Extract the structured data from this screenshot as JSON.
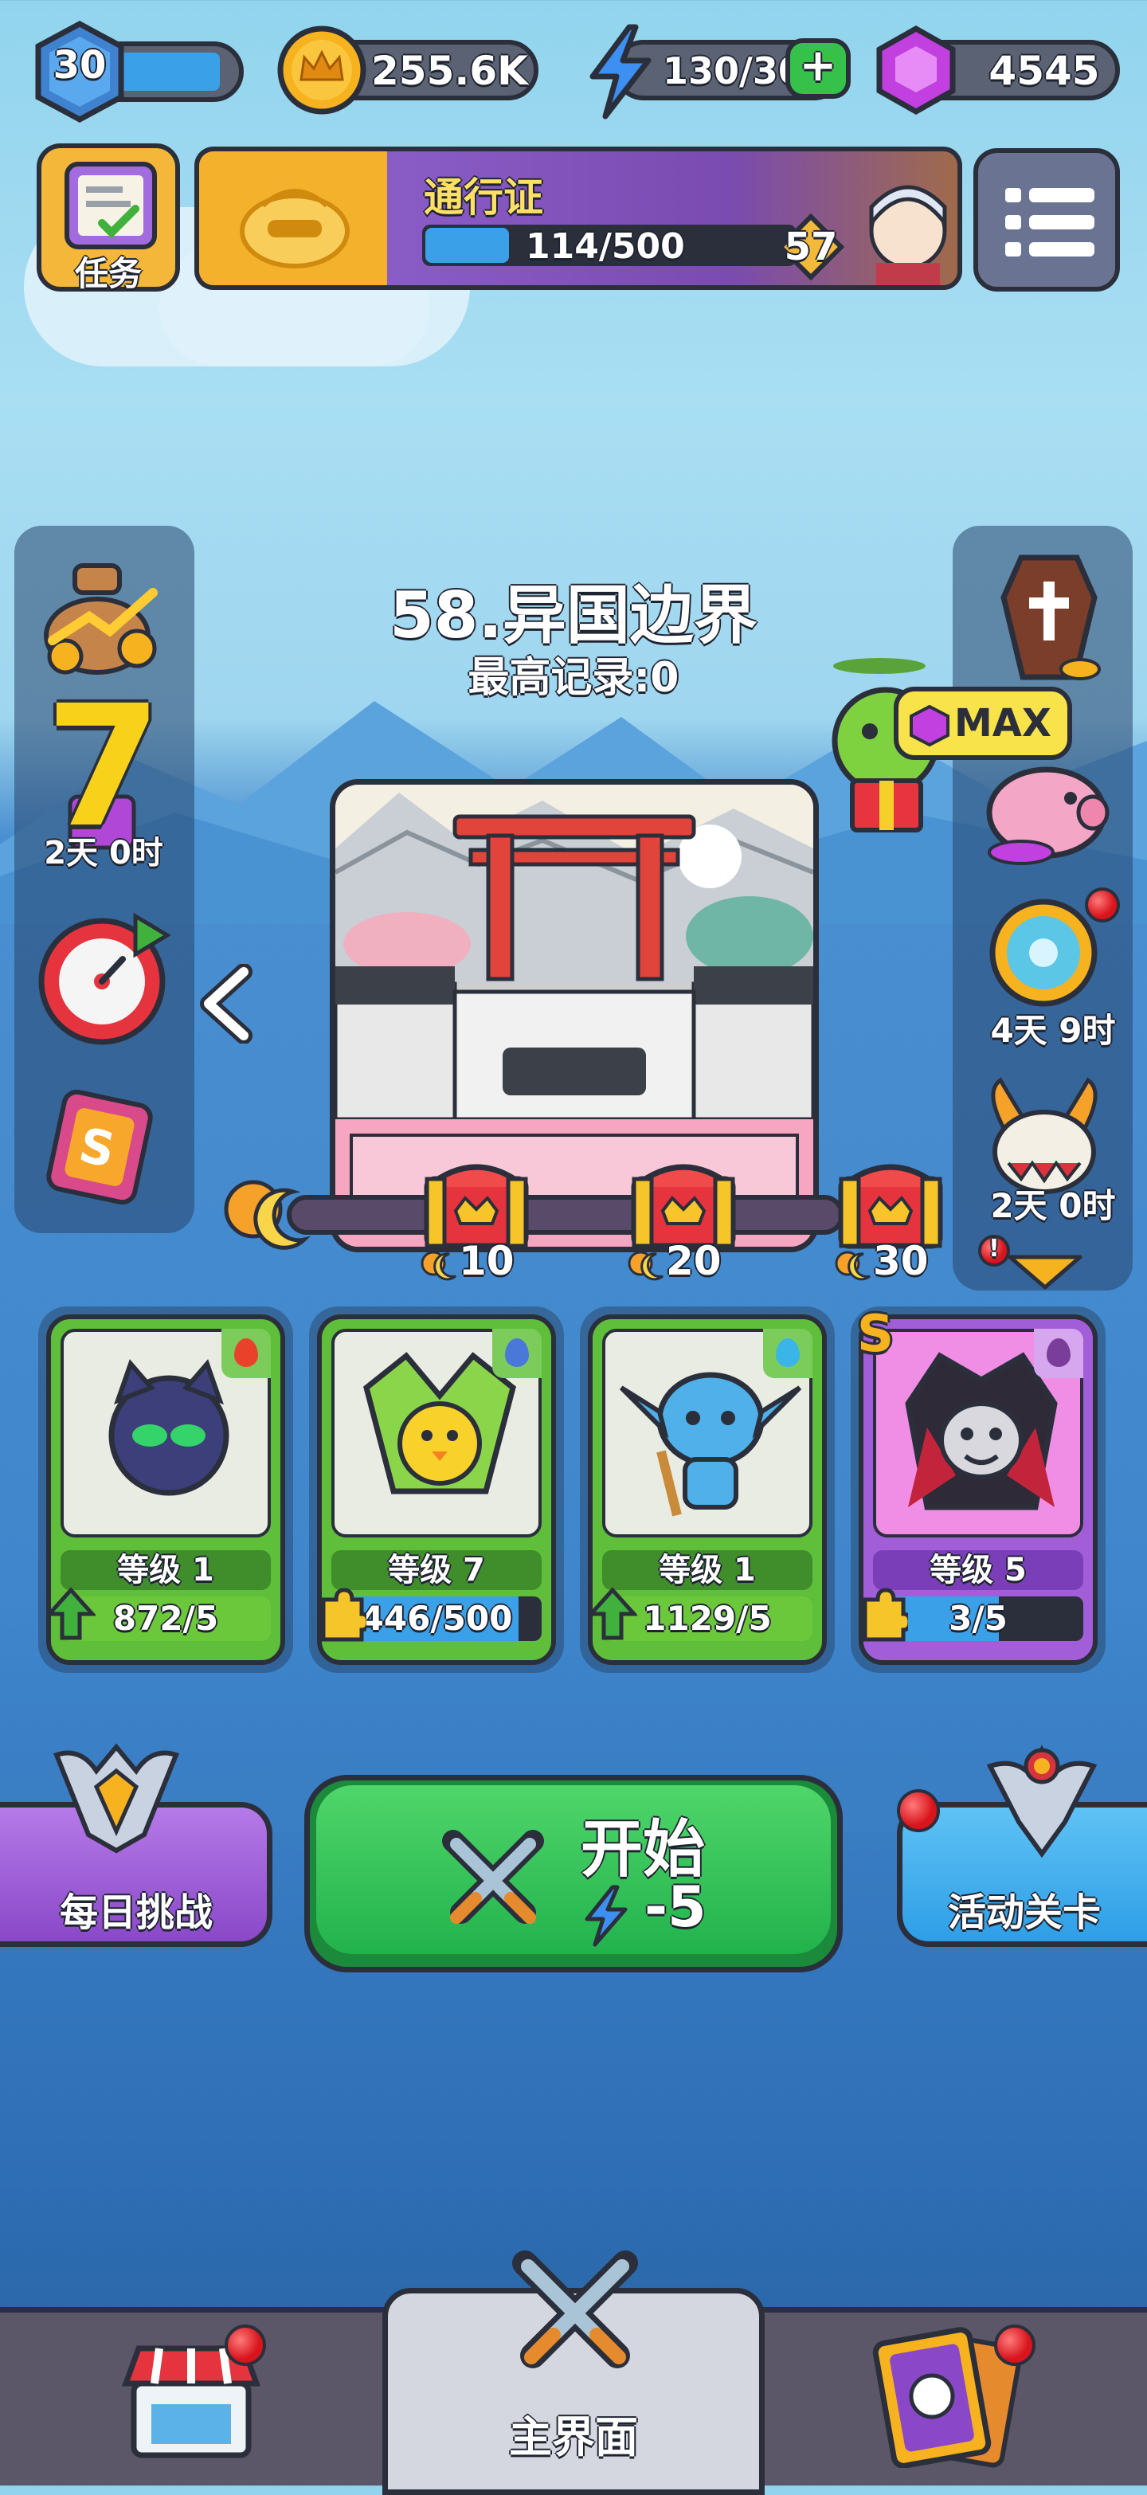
{
  "top_bar": {
    "level": "30",
    "gold": "255.6K",
    "energy": "130/30",
    "gems": "4545"
  },
  "quest_button": {
    "label": "任务"
  },
  "pass": {
    "title": "通行证",
    "progress_text": "114/500",
    "progress": 0.228,
    "tier": "57"
  },
  "stage": {
    "title": "58.异国边界",
    "record": "最高记录:0"
  },
  "left_sidebar": {
    "big_number": "7",
    "timer": "2天 0时"
  },
  "right_sidebar": {
    "max_label": "MAX",
    "timer_1": "4天 9时",
    "timer_2": "2天 0时"
  },
  "milestones": [
    {
      "label": "10"
    },
    {
      "label": "20"
    },
    {
      "label": "30"
    }
  ],
  "heroes": [
    {
      "level": "等级 1",
      "progress": "872/5",
      "fill": 1.0,
      "element": "fire",
      "style": "green",
      "upgrade": true
    },
    {
      "level": "等级 7",
      "progress": "446/500",
      "fill": 0.892,
      "element": "sword",
      "style": "green",
      "upgrade": false
    },
    {
      "level": "等级 1",
      "progress": "1129/5",
      "fill": 1.0,
      "element": "water",
      "style": "green",
      "upgrade": true
    },
    {
      "level": "等级 5",
      "progress": "3/5",
      "fill": 0.6,
      "element": "bat",
      "style": "purple",
      "upgrade": false,
      "rank": "S"
    }
  ],
  "buttons": {
    "daily": "每日挑战",
    "start": "开始",
    "start_cost": "-5",
    "event": "活动关卡"
  },
  "bottom_nav": {
    "main_label": "主界面"
  },
  "colors": {
    "green_btn": "#22b24c",
    "purple_btn": "#9a55d6",
    "blue_btn": "#2e9ee6"
  }
}
